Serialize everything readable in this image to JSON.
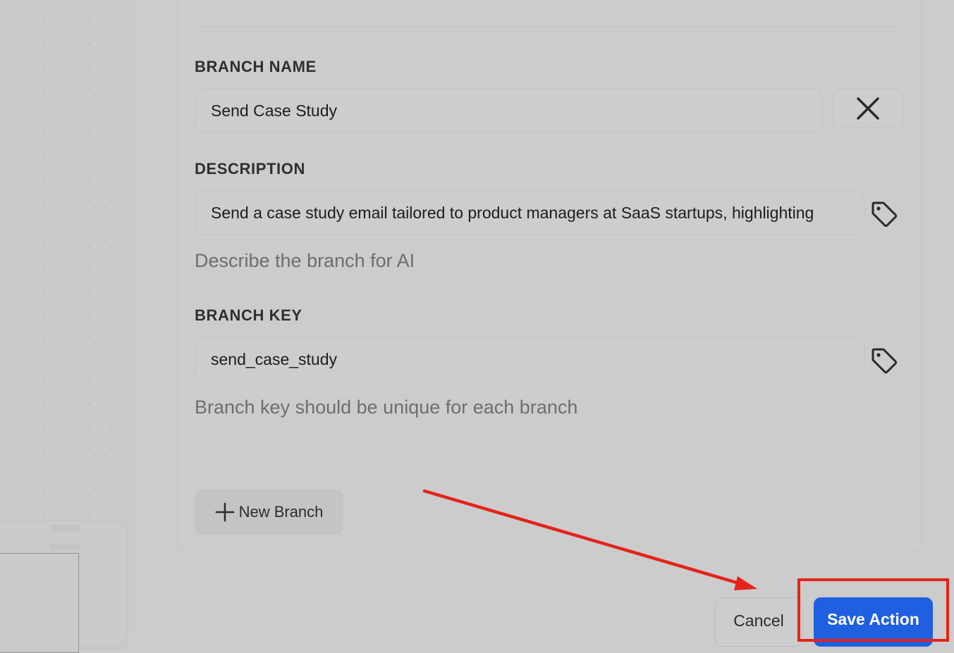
{
  "form": {
    "branch_name_label": "BRANCH NAME",
    "branch_name_value": "Send Case Study",
    "description_label": "DESCRIPTION",
    "description_value": "Send a case study email tailored to product managers at SaaS startups, highlighting",
    "description_hint": "Describe the branch for AI",
    "branch_key_label": "BRANCH KEY",
    "branch_key_value": "send_case_study",
    "branch_key_hint": "Branch key should be unique for each branch"
  },
  "actions": {
    "new_branch_label": "New Branch",
    "cancel_label": "Cancel",
    "save_label": "Save Action"
  },
  "icons": {
    "close": "close-icon",
    "tag": "tag-icon",
    "plus": "plus-icon"
  },
  "colors": {
    "primary": "#1f5fe0",
    "annotation": "#e4231a"
  }
}
